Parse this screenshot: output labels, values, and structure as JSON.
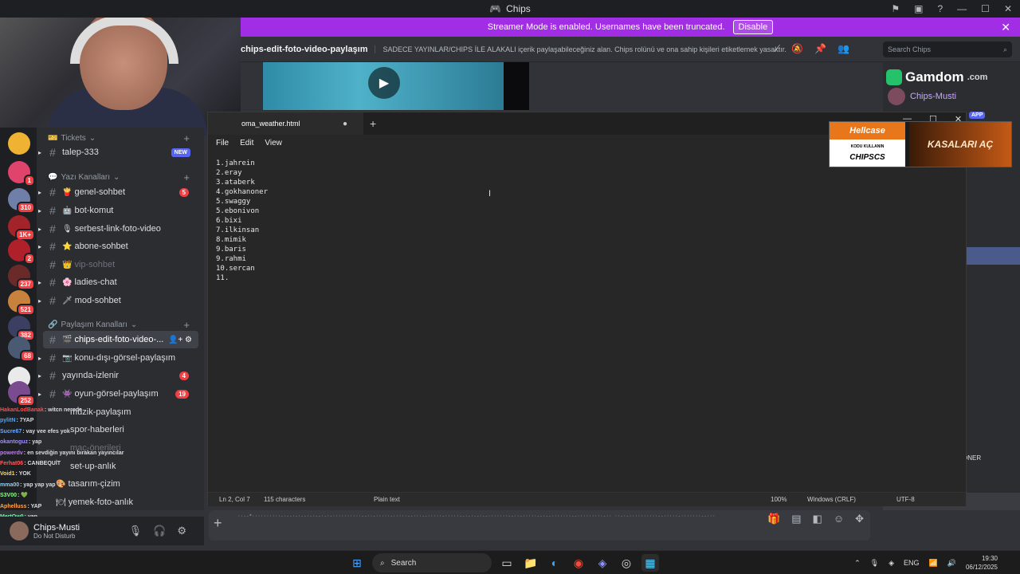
{
  "window": {
    "title": "Chips"
  },
  "banner": {
    "message": "Streamer Mode is enabled. Usernames have been truncated.",
    "button": "Disable"
  },
  "header": {
    "channel": "chips-edit-foto-video-paylaşım",
    "topic": "SADECE YAYINLAR/CHIPS İLE ALAKALI içerik paylaşabileceğiniz alan. Chips rolünü ve ona sahip kişileri etiketlemek yasaktır.",
    "search_placeholder": "Search Chips"
  },
  "servers": [
    {
      "badge": "1"
    },
    {
      "badge": "310"
    },
    {
      "badge": "1K+"
    },
    {
      "badge": "2"
    },
    {
      "badge": "237"
    },
    {
      "badge": "521"
    },
    {
      "badge": "382"
    },
    {
      "badge": "68"
    },
    {
      "badge": ""
    },
    {
      "badge": "252"
    }
  ],
  "sidebar": {
    "cat_tickets": "Tickets",
    "cat_text": "Yazı Kanalları",
    "cat_share": "Paylaşım Kanalları",
    "ticket_channel": {
      "name": "talep-333",
      "badge": "NEW"
    },
    "text_channels": [
      {
        "emoji": "🍟",
        "name": "genel-sohbet",
        "count": "5"
      },
      {
        "emoji": "🤖",
        "name": "bot-komut",
        "count": ""
      },
      {
        "emoji": "🎙",
        "name": "serbest-link-foto-video",
        "count": ""
      },
      {
        "emoji": "⭐",
        "name": "abone-sohbet",
        "count": ""
      },
      {
        "emoji": "👑",
        "name": "vip-sohbet",
        "count": ""
      },
      {
        "emoji": "🌸",
        "name": "ladies-chat",
        "count": ""
      },
      {
        "emoji": "🗡",
        "name": "mod-sohbet",
        "count": ""
      }
    ],
    "share_channels": [
      {
        "emoji": "🎬",
        "name": "chips-edit-foto-video-...",
        "count": ""
      },
      {
        "emoji": "📷",
        "name": "konu-dışı-görsel-paylaşım",
        "count": ""
      },
      {
        "emoji": "",
        "name": "yayında-izlenir",
        "count": "4"
      },
      {
        "emoji": "👾",
        "name": "oyun-görsel-paylaşım",
        "count": "19"
      },
      {
        "emoji": "",
        "name": "müzik-paylaşım",
        "count": ""
      },
      {
        "emoji": "",
        "name": "spor-haberleri",
        "count": ""
      },
      {
        "emoji": "",
        "name": "maç-önerileri",
        "count": ""
      },
      {
        "emoji": "",
        "name": "set-up-anlık",
        "count": ""
      },
      {
        "emoji": "🎨",
        "name": "tasarım-çizim",
        "count": ""
      },
      {
        "emoji": "🍽",
        "name": "yemek-foto-anlık",
        "count": ""
      }
    ]
  },
  "chat_overlay": [
    {
      "user": "HakanLodBanak",
      "msg": ": witcn nerede",
      "color": "#ff4d4d"
    },
    {
      "user": "pylitN",
      "msg": ": 7YAP",
      "color": "#4da6ff"
    },
    {
      "user": "Sucre67",
      "msg": ": vay vee efes yok",
      "color": "#6fa8ff"
    },
    {
      "user": "okantoguz",
      "msg": ": yap",
      "color": "#9f8cff"
    },
    {
      "user": "powerdv",
      "msg": ": en sevdiğin yayını bırakan yayıncılar",
      "color": "#c774ff"
    },
    {
      "user": "Ferhat06",
      "msg": ": CANBEQUİT",
      "color": "#ff5c5c"
    },
    {
      "user": "Void1",
      "msg": ": YOK",
      "color": "#ffd84d"
    },
    {
      "user": "mma00",
      "msg": ": yap yap yap",
      "color": "#7fd3ff"
    },
    {
      "user": "S3V00",
      "msg": ": 💚",
      "color": "#8cff8c"
    },
    {
      "user": "Aphelluss",
      "msg": ": YAP",
      "color": "#ffa64d"
    },
    {
      "user": "MertOw0",
      "msg": ": yap",
      "color": "#5cff9d"
    }
  ],
  "user_panel": {
    "name": "Chips-Musti",
    "status": "Do Not Disturb"
  },
  "notepad": {
    "tab_title": "oma_weather.html",
    "menu": [
      "File",
      "Edit",
      "View"
    ],
    "lines": [
      "1.jahrein",
      "2.eray",
      "3.ataberk",
      "4.gokhanoner",
      "5.swaggy",
      "5.ebonivon",
      "6.bixi",
      "7.ilkinsan",
      "8.mimik",
      "9.baris",
      "9.rahmi",
      "10.sercan",
      "11."
    ],
    "status": {
      "position": "Ln 2, Col 7",
      "chars": "115 characters",
      "format": "Plain text",
      "zoom": "100%",
      "eol": "Windows (CRLF)",
      "encoding": "UTF-8"
    }
  },
  "members": {
    "sponsor": "Gamdom",
    "sponsor_suffix": ".com",
    "member1": "Chips-Musti",
    "app_tag": "APP",
    "role_text": "ONER"
  },
  "ad": {
    "brand": "Hellcase",
    "code_label": "KODU KULLANIN",
    "code": "CHIPSCS",
    "cta": "KASALARI AÇ"
  },
  "composer": {
    "garbled": "··--*··········-·--·-·--·-·--·-·-··········--··-·····-·····--···--·····-·····--·-·--·--·······--··-·····--·--·······--·········-·· ··-·-··········--·····-·······--···"
  },
  "taskbar": {
    "search": "Search",
    "lang": "ENG",
    "time": "19:30",
    "date": "06/12/2025"
  }
}
